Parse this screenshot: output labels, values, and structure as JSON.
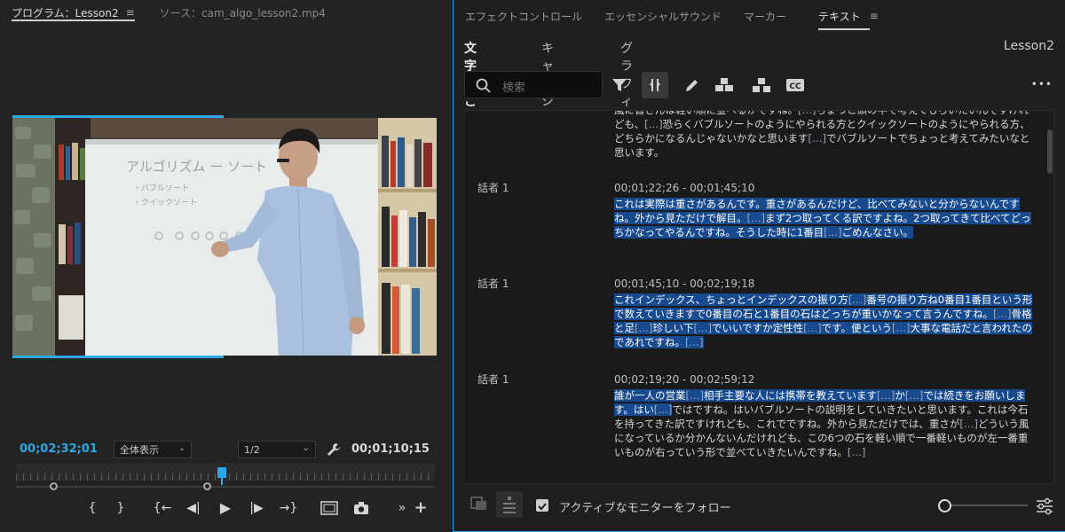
{
  "program": {
    "tab_label": "プログラム：Lesson2",
    "source_tab_label": "ソース：cam_algo_lesson2.mp4",
    "menu_glyph": "≡",
    "current_timecode": "00;02;32;01",
    "zoom_select": "全体表示",
    "resolution_select": "1/2",
    "duration_timecode": "00;01;10;15",
    "whiteboard_text": "アルゴリズム ー ソート",
    "whiteboard_sub1": "・バブルソート",
    "whiteboard_sub2": "・クイックソート",
    "accent_color": "#2ea7e6"
  },
  "transport": {
    "mark_in": "{",
    "mark_out": "}",
    "go_to_in": "{←",
    "step_back": "◀|",
    "play": "▶",
    "step_forward": "|▶",
    "go_to_out": "→}",
    "more": "»",
    "add": "+"
  },
  "panel": {
    "tabs": [
      "エフェクトコントロール",
      "エッセンシャルサウンド",
      "マーカー",
      "テキスト"
    ],
    "active_tab": "テキスト",
    "menu_glyph": "≡",
    "subtabs": [
      "文字起こし",
      "キャプション",
      "グラフィック"
    ],
    "sequence_name": "Lesson2",
    "search_placeholder": "検索",
    "more_glyph": "•••",
    "highlight_color": "#174a8e"
  },
  "transcript": {
    "top_para": [
      {
        "t": "風に皆さんは軽い順に並べるかですね。",
        "h": false
      },
      {
        "t": "[…]",
        "h": false,
        "e": true
      },
      {
        "t": "ちょっと頭の中で考えてもらいたいんですけれども、",
        "h": false
      },
      {
        "t": "[…]",
        "h": false,
        "e": true
      },
      {
        "t": "恐らくバブルソートのようにやられる方とクイックソートのようにやられる方、どちらかになるんじゃないかなと思います",
        "h": false
      },
      {
        "t": "[…]",
        "h": false,
        "e": true
      },
      {
        "t": "でバブルソートでちょっと考えてみたいなと思います。",
        "h": false
      }
    ],
    "blocks": [
      {
        "speaker": "話者 1",
        "timecode": "00;01;22;26 - 00;01;45;10",
        "segments": [
          {
            "t": "これは実際は重さがあるんです。重さがあるんだけど、比べてみないと分からないんですね。外から見ただけで解目。",
            "h": true
          },
          {
            "t": "[…]",
            "h": true,
            "e": true
          },
          {
            "t": "まず2つ取ってくる訳ですよね。2つ取ってきて比べてどっちかなってやるんですね。そうした時に1番目",
            "h": true
          },
          {
            "t": "[…]",
            "h": true,
            "e": true
          },
          {
            "t": "ごめんなさい。",
            "h": true
          }
        ]
      },
      {
        "speaker": "話者 1",
        "timecode": "00;01;45;10 - 00;02;19;18",
        "segments": [
          {
            "t": "これインデックス、ちょっとインデックスの振り方",
            "h": true
          },
          {
            "t": "[…]",
            "h": true,
            "e": true
          },
          {
            "t": "番号の振り方ね0番目1番目という形で数えていきますで0番目の石と1番目の石はどっちが重いかなって言うんですね。",
            "h": true
          },
          {
            "t": "[…]",
            "h": true,
            "e": true
          },
          {
            "t": "骨格と足",
            "h": true
          },
          {
            "t": "[…]",
            "h": true,
            "e": true
          },
          {
            "t": "珍しい下",
            "h": true
          },
          {
            "t": "[…]",
            "h": true,
            "e": true
          },
          {
            "t": "でいいですか定性性",
            "h": true
          },
          {
            "t": "[…]",
            "h": true,
            "e": true
          },
          {
            "t": "です。便という",
            "h": true
          },
          {
            "t": "[…]",
            "h": true,
            "e": true
          },
          {
            "t": "大事な電話だと言われたのであれですね。",
            "h": true
          },
          {
            "t": "[…]",
            "h": true,
            "e": true
          }
        ]
      },
      {
        "speaker": "話者 1",
        "timecode": "00;02;19;20 - 00;02;59;12",
        "segments": [
          {
            "t": "誰が一人の営業",
            "h": true
          },
          {
            "t": "[…]",
            "h": true,
            "e": true
          },
          {
            "t": "相手主要な人には携帯を教えています",
            "h": true
          },
          {
            "t": "[…]",
            "h": true,
            "e": true
          },
          {
            "t": "か",
            "h": true
          },
          {
            "t": "[…]",
            "h": true,
            "e": true
          },
          {
            "t": "では続きをお願いします。はい",
            "h": true
          },
          {
            "t": "[…]",
            "h": true,
            "e": true
          },
          {
            "t": "ではですね。はいバブルソートの説明をしていきたいと思います。これは今石を持ってきた訳ですけれども、これでですね。外から見ただけでは、重さが",
            "h": false
          },
          {
            "t": "[…]",
            "h": false,
            "e": true
          },
          {
            "t": "どういう風になっているか分かんないんだけれども、この6つの石を軽い順で一番軽いものが左一番重いものが右っていう形で並べていきたいんですね。",
            "h": false
          },
          {
            "t": "[…]",
            "h": false,
            "e": true
          }
        ]
      }
    ]
  },
  "footer": {
    "follow_label": "アクティブなモニターをフォロー",
    "follow_checked": true
  }
}
